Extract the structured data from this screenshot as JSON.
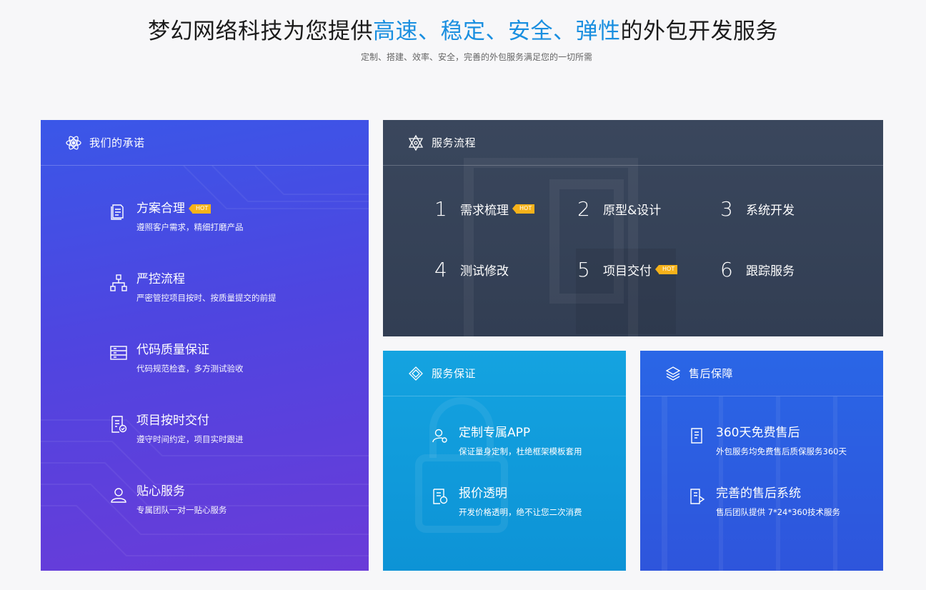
{
  "hero": {
    "title_prefix": "梦幻网络科技为您提供",
    "highlight": "高速、稳定、安全、弹性",
    "title_suffix": "的外包开发服务",
    "subtitle": "定制、搭建、效率、安全，完善的外包服务满足您的一切所需"
  },
  "promise": {
    "title": "我们的承诺",
    "items": [
      {
        "title": "方案合理",
        "hot": "HOT",
        "desc": "遵照客户需求，精细打磨产品",
        "icon": "document-icon"
      },
      {
        "title": "严控流程",
        "desc": "严密管控项目按时、按质量提交的前提",
        "icon": "flowchart-icon"
      },
      {
        "title": "代码质量保证",
        "desc": "代码规范检查，多方测试验收",
        "icon": "server-icon"
      },
      {
        "title": "项目按时交付",
        "desc": "遵守时间约定，项目实时跟进",
        "icon": "checklist-icon"
      },
      {
        "title": "贴心服务",
        "desc": "专属团队一对一贴心服务",
        "icon": "user-icon"
      }
    ]
  },
  "process": {
    "title": "服务流程",
    "steps": [
      {
        "num": "1",
        "label": "需求梳理",
        "hot": "HOT"
      },
      {
        "num": "2",
        "label": "原型&设计"
      },
      {
        "num": "3",
        "label": "系统开发"
      },
      {
        "num": "4",
        "label": "测试修改"
      },
      {
        "num": "5",
        "label": "项目交付",
        "hot": "HOT"
      },
      {
        "num": "6",
        "label": "跟踪服务"
      }
    ]
  },
  "guarantee": {
    "title": "服务保证",
    "items": [
      {
        "title": "定制专属APP",
        "desc": "保证量身定制，杜绝框架模板套用"
      },
      {
        "title": "报价透明",
        "desc": "开发价格透明，绝不让您二次消费"
      }
    ]
  },
  "aftersale": {
    "title": "售后保障",
    "items": [
      {
        "title": "360天免费售后",
        "desc": "外包服务均免费售后质保服务360天"
      },
      {
        "title": "完善的售后系统",
        "desc": "售后团队提供 7*24*360技术服务"
      }
    ]
  },
  "colors": {
    "highlight": "#1a8fe0",
    "hot_badge": "#f6b21a"
  }
}
